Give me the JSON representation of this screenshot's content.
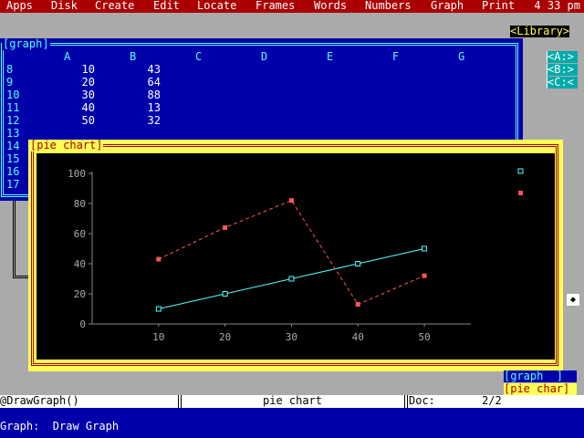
{
  "menu": {
    "items": [
      "Apps",
      "Disk",
      "Create",
      "Edit",
      "Locate",
      "Frames",
      "Words",
      "Numbers",
      "Graph",
      "Print"
    ],
    "clock": "4 33 pm"
  },
  "sheet": {
    "title": "[graph]",
    "columns": [
      "A",
      "B",
      "C",
      "D",
      "E",
      "F",
      "G"
    ],
    "rows": [
      {
        "num": "8",
        "a": "10",
        "b": "43"
      },
      {
        "num": "9",
        "a": "20",
        "b": "64"
      },
      {
        "num": "10",
        "a": "30",
        "b": "88"
      },
      {
        "num": "11",
        "a": "40",
        "b": "13"
      },
      {
        "num": "12",
        "a": "50",
        "b": "32"
      },
      {
        "num": "13",
        "a": "",
        "b": ""
      },
      {
        "num": "14",
        "a": "",
        "b": ""
      },
      {
        "num": "15",
        "a": "",
        "b": ""
      },
      {
        "num": "16",
        "a": "",
        "b": ""
      },
      {
        "num": "17",
        "a": "",
        "b": ""
      }
    ]
  },
  "chart_frame": {
    "title": "[pie chart]"
  },
  "chart_data": {
    "type": "line",
    "x": [
      10,
      20,
      30,
      40,
      50
    ],
    "xlim": [
      0,
      57
    ],
    "ylim": [
      0,
      100
    ],
    "yticks": [
      0,
      20,
      40,
      60,
      80,
      100
    ],
    "grid": false,
    "legend": "right",
    "series": [
      {
        "values": [
          10,
          20,
          30,
          40,
          50
        ],
        "color": "#55ffff",
        "marker": "hollow-square",
        "style": "solid"
      },
      {
        "values": [
          43,
          64,
          82,
          13,
          32
        ],
        "color": "#ff5555",
        "marker": "filled-square",
        "style": "dashed"
      }
    ]
  },
  "sidebar": {
    "library": "<Library>",
    "drives": [
      "<A:>",
      "<B:>",
      "<C:<"
    ]
  },
  "tabs": {
    "graph": "[graph  ]",
    "pie": "[pie char]"
  },
  "status": {
    "formula": "@DrawGraph()",
    "frame_name": "pie chart",
    "doc_label": "Doc:",
    "doc_page": "2/2"
  },
  "prompt": {
    "text": "Graph:  Draw Graph"
  },
  "colors": {
    "menubar": "#aa0000",
    "sheet_bg": "#0000aa",
    "accent_cyan": "#55ffff",
    "chart_frame": "#ffff55",
    "series_red": "#ff5555"
  }
}
